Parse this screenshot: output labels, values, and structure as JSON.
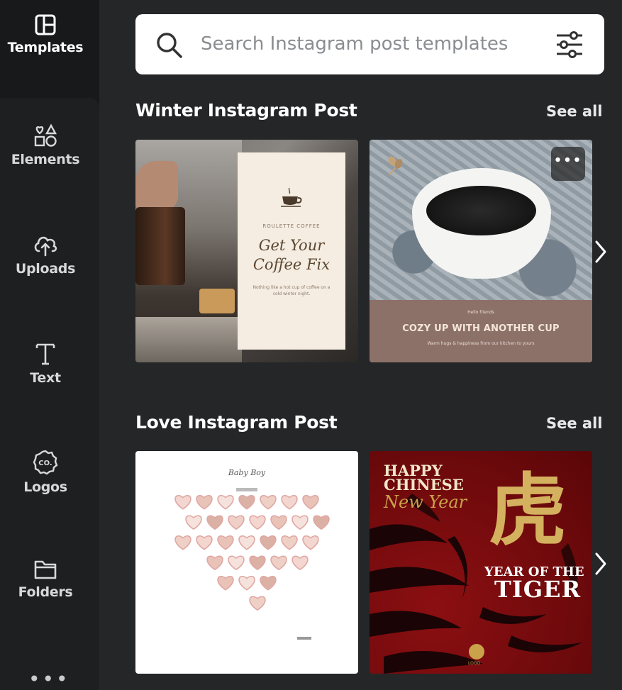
{
  "sidebar": {
    "items": [
      {
        "id": "templates",
        "label": "Templates",
        "icon": "templates-icon",
        "active": true
      },
      {
        "id": "elements",
        "label": "Elements",
        "icon": "shapes-icon"
      },
      {
        "id": "uploads",
        "label": "Uploads",
        "icon": "cloud-upload-icon"
      },
      {
        "id": "text",
        "label": "Text",
        "icon": "text-icon"
      },
      {
        "id": "logos",
        "label": "Logos",
        "icon": "logo-badge-icon"
      },
      {
        "id": "folders",
        "label": "Folders",
        "icon": "folder-icon"
      }
    ],
    "more_label": "•••"
  },
  "search": {
    "placeholder": "Search Instagram post templates",
    "value": ""
  },
  "sections": [
    {
      "title": "Winter Instagram Post",
      "see_all": "See all",
      "cards": [
        {
          "type": "coffee-fix",
          "small_label": "ROULETTE COFFEE",
          "headline_line1": "Get Your",
          "headline_line2": "Coffee Fix",
          "body": "Nothing like a hot cup of coffee on a cold winter night."
        },
        {
          "type": "cozy-cup",
          "top_label": "Hello friends",
          "headline": "COZY UP WITH ANOTHER CUP",
          "bottom_label": "Warm hugs & happiness from our kitchen to yours"
        }
      ]
    },
    {
      "title": "Love Instagram Post",
      "see_all": "See all",
      "cards": [
        {
          "type": "baby-heart",
          "script_title": "Baby Boy"
        },
        {
          "type": "tiger",
          "line1": "HAPPY",
          "line2": "CHINESE",
          "script": "New Year",
          "hanzi": "虎",
          "year_of": "YEAR OF THE",
          "tiger": "TIGER",
          "logo_text": "LOGO"
        }
      ]
    }
  ],
  "colors": {
    "background": "#252627",
    "sidebar": "#18191b",
    "text_primary": "#ffffff",
    "search_bg": "#ffffff",
    "accent_gold": "#d4b15e",
    "tiger_red": "#8b0f12"
  }
}
